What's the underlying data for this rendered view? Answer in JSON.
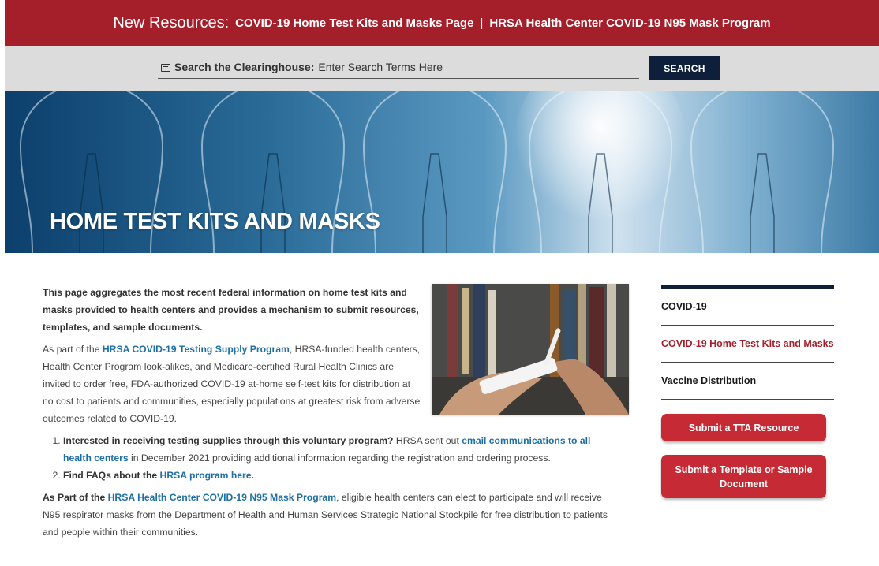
{
  "announcement": {
    "lead": "New Resources:",
    "link1": "COVID-19 Home Test Kits and Masks Page",
    "separator": "|",
    "link2": "HRSA Health Center COVID-19 N95 Mask Program"
  },
  "search": {
    "label": "Search the Clearinghouse:",
    "placeholder": "Enter Search Terms Here",
    "button": "SEARCH"
  },
  "hero": {
    "title": "HOME TEST KITS AND MASKS"
  },
  "content": {
    "intro": "This page aggregates the most recent federal information on home test kits and masks provided to health centers and provides a mechanism to submit resources, templates, and sample documents.",
    "p2_prefix": "As part of the ",
    "p2_link": "HRSA COVID-19 Testing Supply Program",
    "p2_suffix": ", HRSA-funded health centers, Health Center Program look-alikes, and Medicare-certified Rural Health Clinics are invited to order free, FDA-authorized COVID-19 at-home self-test kits for distribution at no cost to patients and communities, especially populations at greatest risk from adverse outcomes related to COVID-19.",
    "list": [
      {
        "question": "Interested in receiving testing supplies through this voluntary program?",
        "mid": " HRSA sent out ",
        "link": "email communications to all health centers",
        "suffix": "  in December 2021 providing additional information regarding the registration and ordering process."
      },
      {
        "question": "Find FAQs about the ",
        "link": "HRSA program here."
      }
    ],
    "p3_prefix": "As Part of the ",
    "p3_link": "HRSA Health Center COVID-19 N95 Mask Program",
    "p3_suffix": ", eligible health centers can elect to participate and will receive N95 respirator masks from the Department of Health and Human Services Strategic National Stockpile for free distribution to patients and people within their communities."
  },
  "sidebar": {
    "items": [
      {
        "label": "COVID-19"
      },
      {
        "label": "COVID-19 Home Test Kits and Masks",
        "active": true
      },
      {
        "label": "Vaccine Distribution"
      }
    ],
    "buttons": [
      {
        "label": "Submit a TTA Resource"
      },
      {
        "label": "Submit a Template or Sample Document"
      }
    ]
  },
  "colors": {
    "banner": "#a51f2b",
    "search_button": "#0e1f3c",
    "link": "#1d6fa5",
    "active_nav": "#a51f2b",
    "cta_button": "#c62a35"
  }
}
